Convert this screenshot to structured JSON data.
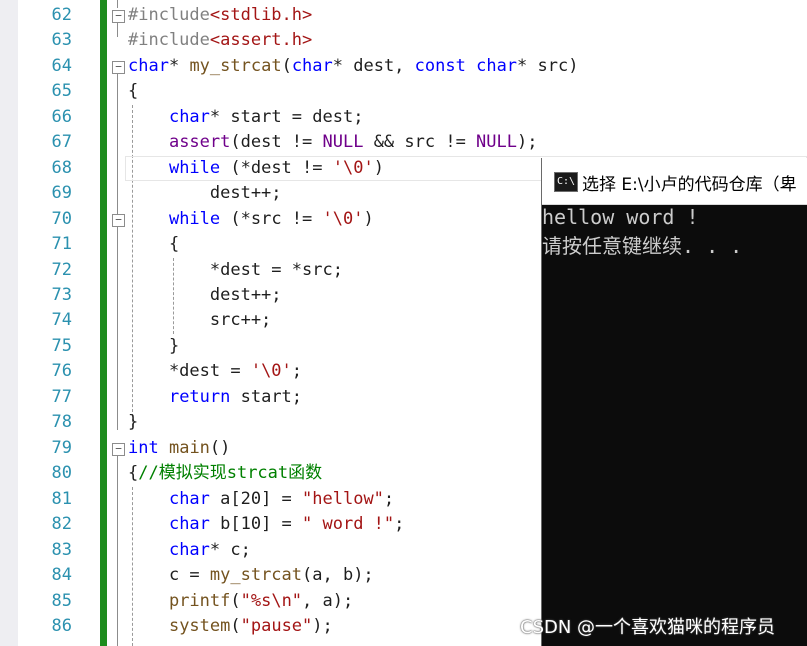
{
  "editor": {
    "line_numbers": [
      "62",
      "63",
      "64",
      "65",
      "66",
      "67",
      "68",
      "69",
      "70",
      "71",
      "72",
      "73",
      "74",
      "75",
      "76",
      "77",
      "78",
      "79",
      "80",
      "81",
      "82",
      "83",
      "84",
      "85",
      "86"
    ],
    "lines": [
      "#include<stdlib.h>",
      "#include<assert.h>",
      "char* my_strcat(char* dest, const char* src)",
      "{",
      "    char* start = dest;",
      "    assert(dest != NULL && src != NULL);",
      "    while (*dest != '\\0')",
      "        dest++;",
      "    while (*src != '\\0')",
      "    {",
      "        *dest = *src;",
      "        dest++;",
      "        src++;",
      "    }",
      "    *dest = '\\0';",
      "    return start;",
      "}",
      "int main()",
      "{//模拟实现strcat函数",
      "    char a[20] = \"hellow\";",
      "    char b[10] = \" word !\";",
      "    char* c;",
      "    c = my_strcat(a, b);",
      "    printf(\"%s\\n\", a);",
      "    system(\"pause\");"
    ]
  },
  "console": {
    "title": "选择 E:\\小卢的代码仓库（卑",
    "icon_text": "C:\\",
    "output": [
      "hellow word !",
      "请按任意键继续. . ."
    ]
  },
  "watermark": "CSDN @一个喜欢猫咪的程序员",
  "colors": {
    "keyword": "#0000ff",
    "string": "#a31515",
    "macro": "#6f008a",
    "comment": "#008000",
    "line_number": "#2b91af",
    "change_bar": "#1e8c1e",
    "console_bg": "#0c0c0c"
  }
}
